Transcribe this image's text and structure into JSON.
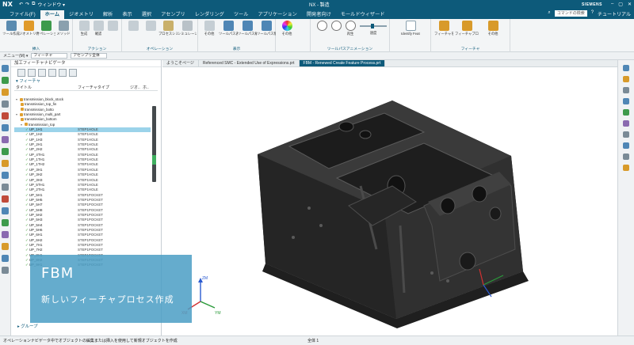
{
  "titlebar": {
    "app_logo": "NX",
    "quick_access": [
      "↶",
      "↷",
      "⧉",
      "ウィンドウ ▾"
    ],
    "document": "NX - 製造",
    "brand": "SIEMENS",
    "window_controls": [
      "–",
      "▢",
      "✕"
    ]
  },
  "menu": {
    "tabs": [
      "ファイル(F)",
      "ホーム",
      "ジオメトリ",
      "解析",
      "表示",
      "選択",
      "アセンブリ",
      "レンダリング",
      "ツール",
      "アプリケーション",
      "開発者向け",
      "モールドウィザード"
    ],
    "active_index": 1,
    "search_placeholder": "コマンドの検索",
    "help_label": "チュートリアル"
  },
  "ribbon": {
    "groups": [
      {
        "name": "挿入",
        "buttons": [
          "ツール作成",
          "ジオメトリ作成",
          "オペレーション作成",
          "メソッド"
        ]
      },
      {
        "name": "アクション",
        "buttons": [
          "生成",
          "確認",
          "",
          ""
        ]
      },
      {
        "name": "オペレーション",
        "buttons": [
          "",
          "",
          "プロセスシミュレート",
          "シミュレーション"
        ]
      },
      {
        "name": "表示",
        "buttons": [
          "その他",
          "ツールパス表示",
          "ツールパス編集",
          "ツールパス削除"
        ]
      },
      {
        "name": "",
        "buttons": [
          "その他"
        ]
      },
      {
        "name": "ツールパスアニメーション",
        "buttons": [
          "",
          "",
          "再生",
          "速度"
        ]
      },
      {
        "name": "",
        "buttons": [
          "Identify Features"
        ]
      },
      {
        "name": "フィーチャ",
        "buttons": [
          "フィーチャを作成",
          "フィーチャプロセスを作成",
          "その他"
        ]
      }
    ]
  },
  "filterbar": {
    "menu_label": "メニュー(M) ▾",
    "filter_value": "フィーチャ",
    "assembly_value": "アセンブリ全体"
  },
  "navigator": {
    "title": "加工フィーチャナビゲータ",
    "section": "フィーチャ",
    "columns": [
      "タイトル",
      "フィーチャタイプ",
      "ジオ..",
      "ホ.."
    ],
    "rows": [
      {
        "name": "transmission_block_stock",
        "type": "",
        "level": 1,
        "check": false,
        "tri": "▾",
        "icon": true,
        "sel": false
      },
      {
        "name": "transmission_top_fin",
        "type": "",
        "level": 2,
        "check": false,
        "tri": "",
        "icon": true,
        "sel": false
      },
      {
        "name": "transmission_botto",
        "type": "",
        "level": 2,
        "check": false,
        "tri": "",
        "icon": true,
        "sel": false
      },
      {
        "name": "transmission_multi_part",
        "type": "",
        "level": 1,
        "check": false,
        "tri": "▾",
        "icon": true,
        "sel": false
      },
      {
        "name": "transmission_bottom",
        "type": "",
        "level": 2,
        "check": false,
        "tri": "",
        "icon": true,
        "sel": false
      },
      {
        "name": "transmission_top",
        "type": "",
        "level": 2,
        "check": false,
        "tri": "▾",
        "icon": true,
        "sel": false
      },
      {
        "name": "UP_1H1",
        "type": "STEP1HOLE",
        "level": 3,
        "check": true,
        "tri": "",
        "icon": false,
        "sel": true
      },
      {
        "name": "UP_1H2",
        "type": "STEP1HOLE",
        "level": 3,
        "check": true,
        "tri": "",
        "icon": false,
        "sel": false
      },
      {
        "name": "UP_1H3",
        "type": "STEP1HOLE",
        "level": 3,
        "check": true,
        "tri": "",
        "icon": false,
        "sel": false
      },
      {
        "name": "UP_2H1",
        "type": "STEP1HOLE",
        "level": 3,
        "check": true,
        "tri": "",
        "icon": false,
        "sel": false
      },
      {
        "name": "UP_2H2",
        "type": "STEP1HOLE",
        "level": 3,
        "check": true,
        "tri": "",
        "icon": false,
        "sel": false
      },
      {
        "name": "UP_4TH1",
        "type": "STEP1HOLE",
        "level": 3,
        "check": true,
        "tri": "",
        "icon": false,
        "sel": false
      },
      {
        "name": "UP_1TH1",
        "type": "STEP1HOLE",
        "level": 3,
        "check": true,
        "tri": "",
        "icon": false,
        "sel": false
      },
      {
        "name": "UP_1TH2",
        "type": "STEP1HOLE",
        "level": 3,
        "check": true,
        "tri": "",
        "icon": false,
        "sel": false
      },
      {
        "name": "UP_3H1",
        "type": "STEP1HOLE",
        "level": 3,
        "check": true,
        "tri": "",
        "icon": false,
        "sel": false
      },
      {
        "name": "UP_3H2",
        "type": "STEP1HOLE",
        "level": 3,
        "check": true,
        "tri": "",
        "icon": false,
        "sel": false
      },
      {
        "name": "UP_3H3",
        "type": "STEP1HOLE",
        "level": 3,
        "check": true,
        "tri": "",
        "icon": false,
        "sel": false
      },
      {
        "name": "UP_5TH1",
        "type": "STEP1HOLE",
        "level": 3,
        "check": true,
        "tri": "",
        "icon": false,
        "sel": false
      },
      {
        "name": "UP_2TH1",
        "type": "STEP1HOLE",
        "level": 3,
        "check": true,
        "tri": "",
        "icon": false,
        "sel": false
      },
      {
        "name": "UP_5H1",
        "type": "STEP1POCKET",
        "level": 3,
        "check": true,
        "tri": "",
        "icon": false,
        "sel": false
      },
      {
        "name": "UP_5H5",
        "type": "STEP1POCKET",
        "level": 3,
        "check": true,
        "tri": "",
        "icon": false,
        "sel": false
      },
      {
        "name": "UP_5H7",
        "type": "STEP1POCKET",
        "level": 3,
        "check": true,
        "tri": "",
        "icon": false,
        "sel": false
      },
      {
        "name": "UP_5H8",
        "type": "STEP1POCKET",
        "level": 3,
        "check": true,
        "tri": "",
        "icon": false,
        "sel": false
      },
      {
        "name": "UP_5H2",
        "type": "STEP1POCKET",
        "level": 3,
        "check": true,
        "tri": "",
        "icon": false,
        "sel": false
      },
      {
        "name": "UP_5H3",
        "type": "STEP1POCKET",
        "level": 3,
        "check": true,
        "tri": "",
        "icon": false,
        "sel": false
      },
      {
        "name": "UP_5H4",
        "type": "STEP1POCKET",
        "level": 3,
        "check": true,
        "tri": "",
        "icon": false,
        "sel": false
      },
      {
        "name": "UP_5H6",
        "type": "STEP1POCKET",
        "level": 3,
        "check": true,
        "tri": "",
        "icon": false,
        "sel": false
      },
      {
        "name": "UP_6H1",
        "type": "STEP1POCKET",
        "level": 3,
        "check": true,
        "tri": "",
        "icon": false,
        "sel": false
      },
      {
        "name": "UP_6H2",
        "type": "STEP1POCKET",
        "level": 3,
        "check": true,
        "tri": "",
        "icon": false,
        "sel": false
      },
      {
        "name": "UP_7H1",
        "type": "STEP1POCKET",
        "level": 3,
        "check": true,
        "tri": "",
        "icon": false,
        "sel": false
      },
      {
        "name": "UP_7H2",
        "type": "STEP1POCKET",
        "level": 3,
        "check": true,
        "tri": "",
        "icon": false,
        "sel": false
      },
      {
        "name": "UP_8H1",
        "type": "STEP1POCKET",
        "level": 3,
        "check": true,
        "tri": "",
        "icon": false,
        "sel": false
      },
      {
        "name": "UP_8H2",
        "type": "STEP1POCKET",
        "level": 3,
        "check": true,
        "tri": "",
        "icon": false,
        "sel": false
      },
      {
        "name": "UP_9H1",
        "type": "STEP1POCKET",
        "level": 3,
        "check": true,
        "tri": "",
        "icon": false,
        "sel": false
      }
    ],
    "group_label": "グループ",
    "scroll_thumb_color": "#40b060"
  },
  "graphics": {
    "tabs": [
      "ようこそページ",
      "Referenced SMC - Extended Use of Expressions.prt",
      "FBM - Renewed Create Feature Process.prt"
    ],
    "active_tab": 2,
    "axis_labels": {
      "x": "XM",
      "y": "YM",
      "z": "ZM"
    },
    "model_color": "#2e2e2e"
  },
  "caption": {
    "title": "FBM",
    "subtitle": "新しいフィーチャプロセス作成",
    "bg_color": "#4a9dc4"
  },
  "status": {
    "message": "オペレーションナビゲータ中でオブジェクトの編集または挿入を使用して新規オブジェクトを作成",
    "selection": "全体 1"
  },
  "colors": {
    "accent": "#0d5a7a",
    "selection": "#9bd3ea",
    "check": "#3b9b2e"
  }
}
